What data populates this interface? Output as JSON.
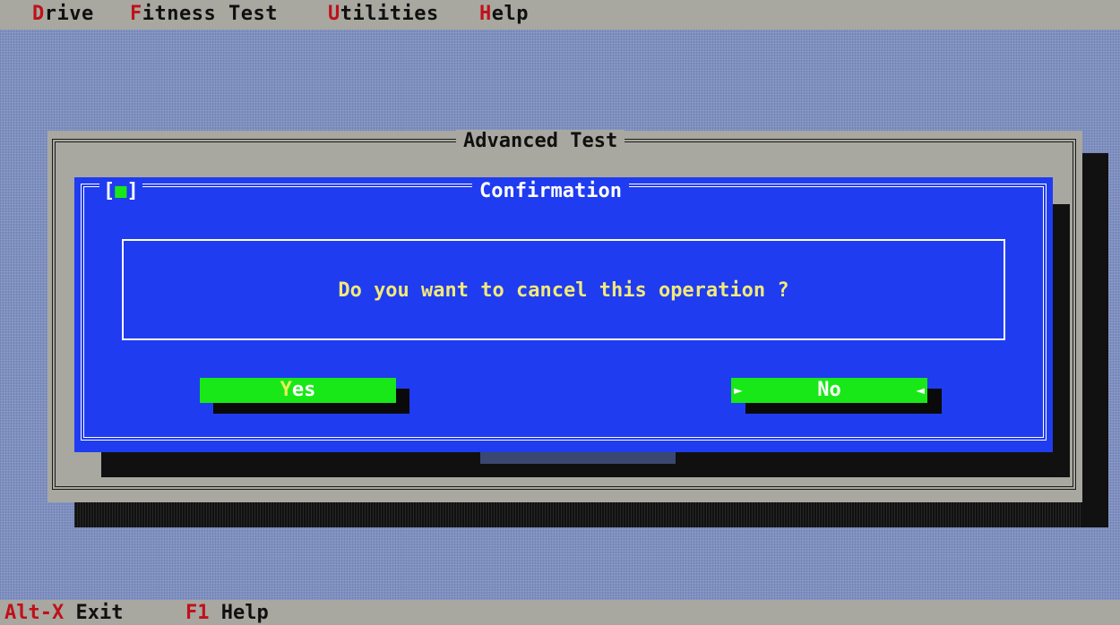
{
  "menu": {
    "items": [
      {
        "hotkey": "D",
        "rest": "rive"
      },
      {
        "hotkey": "F",
        "rest": "itness Test"
      },
      {
        "hotkey": "U",
        "rest": "tilities"
      },
      {
        "hotkey": "H",
        "rest": "elp"
      }
    ]
  },
  "advanced_window": {
    "title": "Advanced Test"
  },
  "confirmation": {
    "close_marker": "[■]",
    "close_open": "[",
    "close_dot": "■",
    "close_close": "]",
    "title": "Confirmation",
    "message": "Do you want to cancel this operation ?",
    "yes_hotkey": "Y",
    "yes_rest": "es",
    "no_label": "No"
  },
  "status": {
    "items": [
      {
        "key": "Alt-X",
        "label": "Exit"
      },
      {
        "key": "F1",
        "label": "Help"
      }
    ]
  },
  "colors": {
    "dialog_blue": "#1f3cf0",
    "button_green": "#19e818",
    "hotkey_red": "#c0101a",
    "message_yellow": "#f2e97a"
  }
}
